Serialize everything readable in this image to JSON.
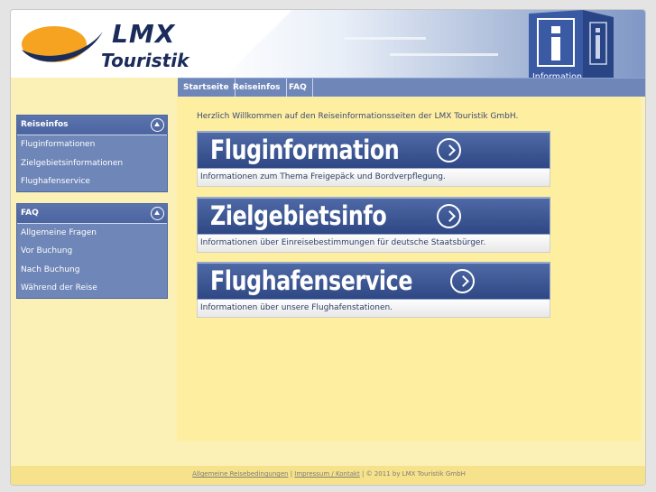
{
  "logo": {
    "line1": "LMX",
    "line2": "Touristik"
  },
  "header": {
    "info_cube_text": "Information"
  },
  "nav": [
    {
      "label": "Startseite"
    },
    {
      "label": "Reiseinfos"
    },
    {
      "label": "FAQ"
    }
  ],
  "sidebar": {
    "reiseinfos": {
      "title": "Reiseinfos",
      "items": [
        "Fluginformationen",
        "Zielgebietsinformationen",
        "Flughafenservice"
      ]
    },
    "faq": {
      "title": "FAQ",
      "items": [
        "Allgemeine Fragen",
        "Vor Buchung",
        "Nach Buchung",
        "Während der Reise"
      ]
    }
  },
  "main": {
    "welcome": "Herzlich Willkommen auf den Reiseinformationsseiten der LMX Touristik GmbH.",
    "banners": [
      {
        "title": "Fluginformation",
        "description": "Informationen zum Thema Freigepäck und Bordverpflegung."
      },
      {
        "title": "Zielgebietsinfo",
        "description": "Informationen über Einreisebestimmungen für deutsche Staatsbürger."
      },
      {
        "title": "Flughafenservice",
        "description": "Informationen über unsere Flughafenstationen."
      }
    ]
  },
  "footer": {
    "link1": "Allgemeine Reisebedingungen",
    "sep1": " | ",
    "link2": "Impressum / Kontakt",
    "copyright": " | © 2011 by LMX Touristik GmbH"
  },
  "colors": {
    "brand_navy": "#1b2c5a",
    "brand_orange": "#f5a321",
    "nav_blue": "#6f86b8",
    "content_yellow": "#fdeea0"
  }
}
